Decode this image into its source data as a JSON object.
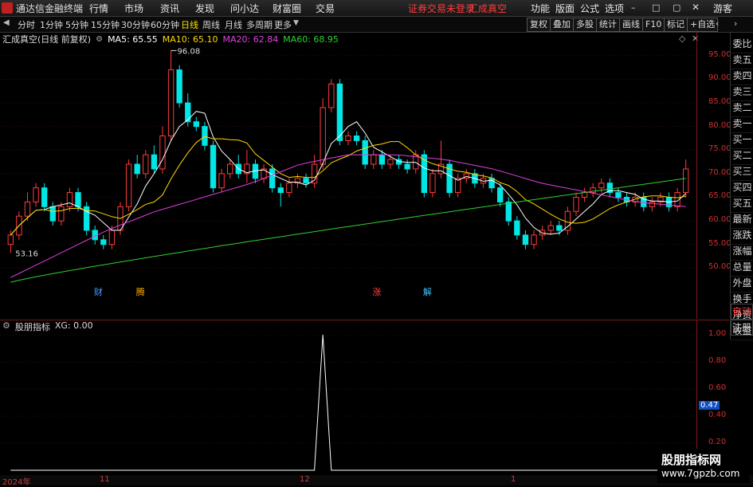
{
  "app": {
    "name": "通达信金融终端"
  },
  "menu": [
    "行情",
    "市场",
    "资讯",
    "发现",
    "问小达",
    "财富圈",
    "交易"
  ],
  "status": {
    "login": "证券交易未登录",
    "stock": "汇成真空"
  },
  "menu_right": [
    "功能",
    "版面",
    "公式",
    "选项",
    "游客"
  ],
  "periods": [
    "分时",
    "1分钟",
    "5分钟",
    "15分钟",
    "30分钟",
    "60分钟",
    "日线",
    "周线",
    "月线",
    "多周期",
    "更多"
  ],
  "active_period": "日线",
  "right_tabs": [
    "复权",
    "叠加",
    "多股",
    "统计",
    "画线",
    "F10",
    "标记",
    "+自选"
  ],
  "title": {
    "stock": "汇成真空(日线 前复权)"
  },
  "ma": {
    "ma5": "MA5: 65.55",
    "ma10": "MA10: 65.10",
    "ma20": "MA20: 62.84",
    "ma60": "MA60: 68.95"
  },
  "sidebar": [
    "委比",
    "卖五",
    "卖四",
    "卖三",
    "卖二",
    "卖一",
    "买一",
    "买二",
    "买三",
    "买四",
    "买五",
    "最新",
    "涨跌",
    "涨幅",
    "总量",
    "外盘",
    "换手",
    "净资",
    "收益"
  ],
  "sidebar2": [
    "自动",
    "注册"
  ],
  "price_axis": [
    "95.00",
    "90.00",
    "85.00",
    "80.00",
    "75.00",
    "70.00",
    "65.00",
    "60.00",
    "55.00",
    "50.00"
  ],
  "high_label": "96.08",
  "low_label": "53.16",
  "event_markers": [
    "财",
    "腾",
    "涨",
    "解"
  ],
  "indicator": {
    "title": "股朋指标",
    "value": "XG: 0.00",
    "axis": [
      "1.00",
      "0.80",
      "0.60",
      "0.47",
      "0.40",
      "0.20"
    ]
  },
  "date_labels": [
    "2024年",
    "11",
    "12",
    "1"
  ],
  "watermark": {
    "line1": "股朋指标网",
    "line2": "www.7gpzb.com"
  },
  "colors": {
    "up": "#ff3c3c",
    "down": "#00e5e5",
    "ma5": "#ffffff",
    "ma10": "#ffd800",
    "ma20": "#e040e0",
    "ma60": "#30d030"
  },
  "chart_data": {
    "type": "candlestick",
    "ylim": [
      46,
      97
    ],
    "candles": [
      [
        55,
        57,
        53.2,
        58
      ],
      [
        57,
        61,
        56,
        62
      ],
      [
        61,
        64,
        60,
        66
      ],
      [
        64,
        67,
        63,
        68
      ],
      [
        67,
        63,
        62,
        68
      ],
      [
        63,
        60,
        59,
        64
      ],
      [
        60,
        63,
        59,
        64
      ],
      [
        63,
        66,
        62,
        67
      ],
      [
        66,
        63,
        62,
        67
      ],
      [
        63,
        58,
        57,
        64
      ],
      [
        58,
        56,
        55,
        59
      ],
      [
        56,
        55,
        54,
        57
      ],
      [
        55,
        58,
        54,
        59
      ],
      [
        58,
        63,
        57,
        64
      ],
      [
        63,
        72,
        62,
        73
      ],
      [
        72,
        70,
        69,
        74
      ],
      [
        70,
        74,
        69,
        75
      ],
      [
        74,
        71,
        70,
        76
      ],
      [
        71,
        78,
        70,
        80
      ],
      [
        78,
        92,
        77,
        96.08
      ],
      [
        92,
        85,
        84,
        93
      ],
      [
        85,
        81,
        80,
        87
      ],
      [
        81,
        80,
        79,
        82
      ],
      [
        80,
        76,
        75,
        81
      ],
      [
        76,
        67,
        66,
        77
      ],
      [
        67,
        70,
        66,
        71
      ],
      [
        70,
        72,
        69,
        73
      ],
      [
        72,
        70,
        69,
        74
      ],
      [
        70,
        72,
        68,
        75
      ],
      [
        72,
        69,
        68,
        73
      ],
      [
        69,
        71,
        68,
        72
      ],
      [
        71,
        67,
        66,
        72
      ],
      [
        67,
        66,
        63,
        68
      ],
      [
        66,
        68,
        65,
        69
      ],
      [
        68,
        69,
        67,
        70
      ],
      [
        69,
        68,
        67,
        70
      ],
      [
        68,
        72,
        67,
        74
      ],
      [
        72,
        84,
        71,
        86
      ],
      [
        84,
        89,
        83,
        90
      ],
      [
        89,
        77,
        76,
        90
      ],
      [
        77,
        78,
        76,
        79
      ],
      [
        78,
        77,
        76,
        79
      ],
      [
        77,
        72,
        71,
        78
      ],
      [
        72,
        74,
        71,
        75
      ],
      [
        74,
        72,
        71,
        75
      ],
      [
        72,
        73,
        71,
        74
      ],
      [
        73,
        72,
        71,
        74
      ],
      [
        72,
        71,
        70,
        73
      ],
      [
        71,
        74,
        70,
        75
      ],
      [
        74,
        66,
        65,
        75
      ],
      [
        66,
        70,
        65,
        71
      ],
      [
        70,
        72,
        69,
        77
      ],
      [
        72,
        66,
        65,
        73
      ],
      [
        66,
        69,
        65,
        70
      ],
      [
        69,
        70,
        68,
        71
      ],
      [
        70,
        68,
        67,
        71
      ],
      [
        68,
        69,
        67,
        70
      ],
      [
        69,
        67,
        66,
        70
      ],
      [
        67,
        64,
        63,
        68
      ],
      [
        64,
        60,
        59,
        65
      ],
      [
        60,
        57,
        56,
        61
      ],
      [
        57,
        55,
        54,
        58
      ],
      [
        55,
        57,
        54,
        58
      ],
      [
        57,
        58,
        56,
        59
      ],
      [
        58,
        59,
        57,
        60
      ],
      [
        59,
        58,
        57,
        60
      ],
      [
        58,
        62,
        57,
        63
      ],
      [
        62,
        65,
        61,
        66
      ],
      [
        65,
        66,
        64,
        67
      ],
      [
        66,
        67,
        65,
        68
      ],
      [
        67,
        68,
        66,
        69
      ],
      [
        68,
        66,
        65,
        69
      ],
      [
        66,
        65,
        64,
        67
      ],
      [
        65,
        64,
        63,
        66
      ],
      [
        64,
        65,
        63,
        66
      ],
      [
        65,
        63,
        62,
        66
      ],
      [
        63,
        64,
        62,
        65
      ],
      [
        64,
        65,
        63,
        66
      ],
      [
        65,
        63,
        62,
        66
      ],
      [
        63,
        66,
        62,
        67
      ],
      [
        66,
        71,
        65,
        73
      ]
    ],
    "indicator_values_note": "spike at index 37",
    "indicator_values": [
      0,
      0,
      0,
      0,
      0,
      0,
      0,
      0,
      0,
      0,
      0,
      0,
      0,
      0,
      0,
      0,
      0,
      0,
      0,
      0,
      0,
      0,
      0,
      0,
      0,
      0,
      0,
      0,
      0,
      0,
      0,
      0,
      0,
      0,
      0,
      0,
      0,
      1,
      0,
      0,
      0,
      0,
      0,
      0,
      0,
      0,
      0,
      0,
      0,
      0,
      0,
      0,
      0,
      0,
      0,
      0,
      0,
      0,
      0,
      0,
      0,
      0,
      0,
      0,
      0,
      0,
      0,
      0,
      0,
      0,
      0,
      0,
      0,
      0,
      0,
      0,
      0,
      0,
      0,
      0,
      0
    ]
  }
}
